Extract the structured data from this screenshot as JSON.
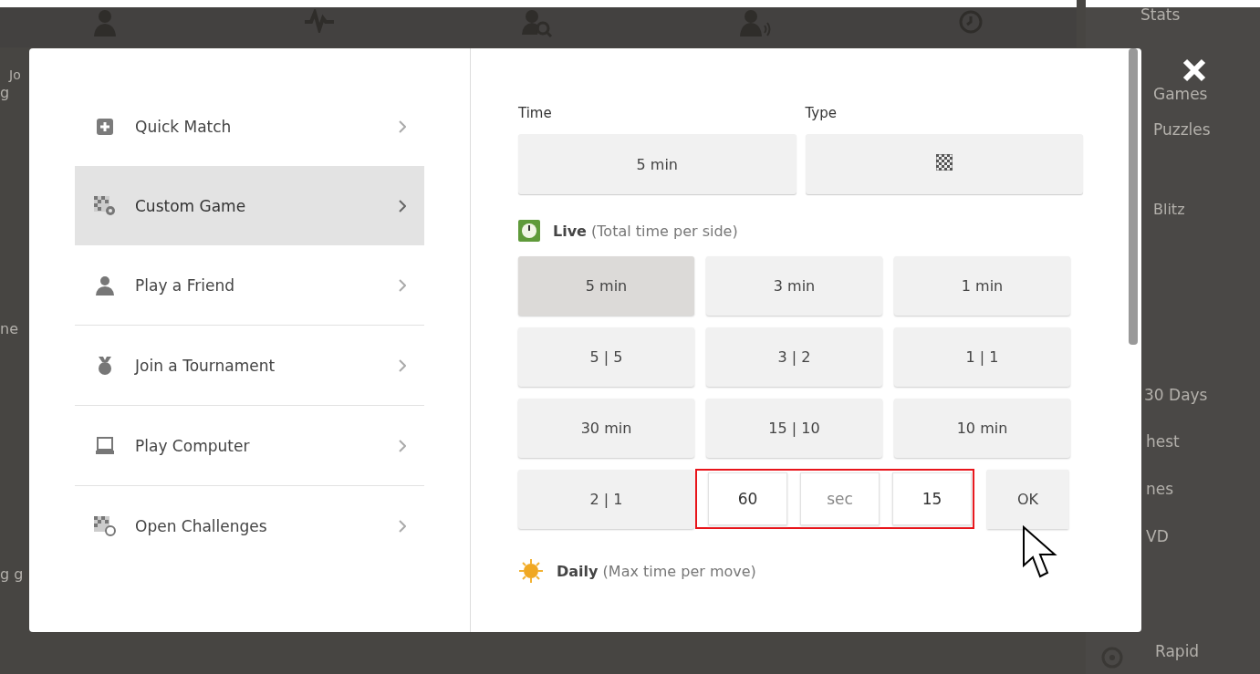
{
  "background": {
    "left_fragments": [
      "Jo",
      "g",
      "ne",
      "g g"
    ],
    "sidebar_texts": [
      "Stats",
      "Games",
      "Puzzles",
      "Blitz",
      "30 Days",
      "hest",
      "nes",
      "VD",
      "Rapid"
    ]
  },
  "menu": [
    {
      "label": "Quick Match",
      "selected": false
    },
    {
      "label": "Custom Game",
      "selected": true
    },
    {
      "label": "Play a Friend",
      "selected": false
    },
    {
      "label": "Join a Tournament",
      "selected": false
    },
    {
      "label": "Play Computer",
      "selected": false
    },
    {
      "label": "Open Challenges",
      "selected": false
    }
  ],
  "time_label": "Time",
  "type_label": "Type",
  "time_value": "5 min",
  "live": {
    "title": "Live",
    "note": "(Total time per side)"
  },
  "presets": [
    {
      "label": "5 min",
      "selected": true
    },
    {
      "label": "3 min",
      "selected": false
    },
    {
      "label": "1 min",
      "selected": false
    },
    {
      "label": "5 | 5",
      "selected": false
    },
    {
      "label": "3 | 2",
      "selected": false
    },
    {
      "label": "1 | 1",
      "selected": false
    },
    {
      "label": "30 min",
      "selected": false
    },
    {
      "label": "15 | 10",
      "selected": false
    },
    {
      "label": "10 min",
      "selected": false
    },
    {
      "label": "2 | 1",
      "selected": false
    }
  ],
  "custom": {
    "minutes": "60",
    "unit_placeholder": "sec",
    "increment": "15",
    "ok": "OK"
  },
  "daily": {
    "title": "Daily",
    "note": "(Max time per move)"
  }
}
